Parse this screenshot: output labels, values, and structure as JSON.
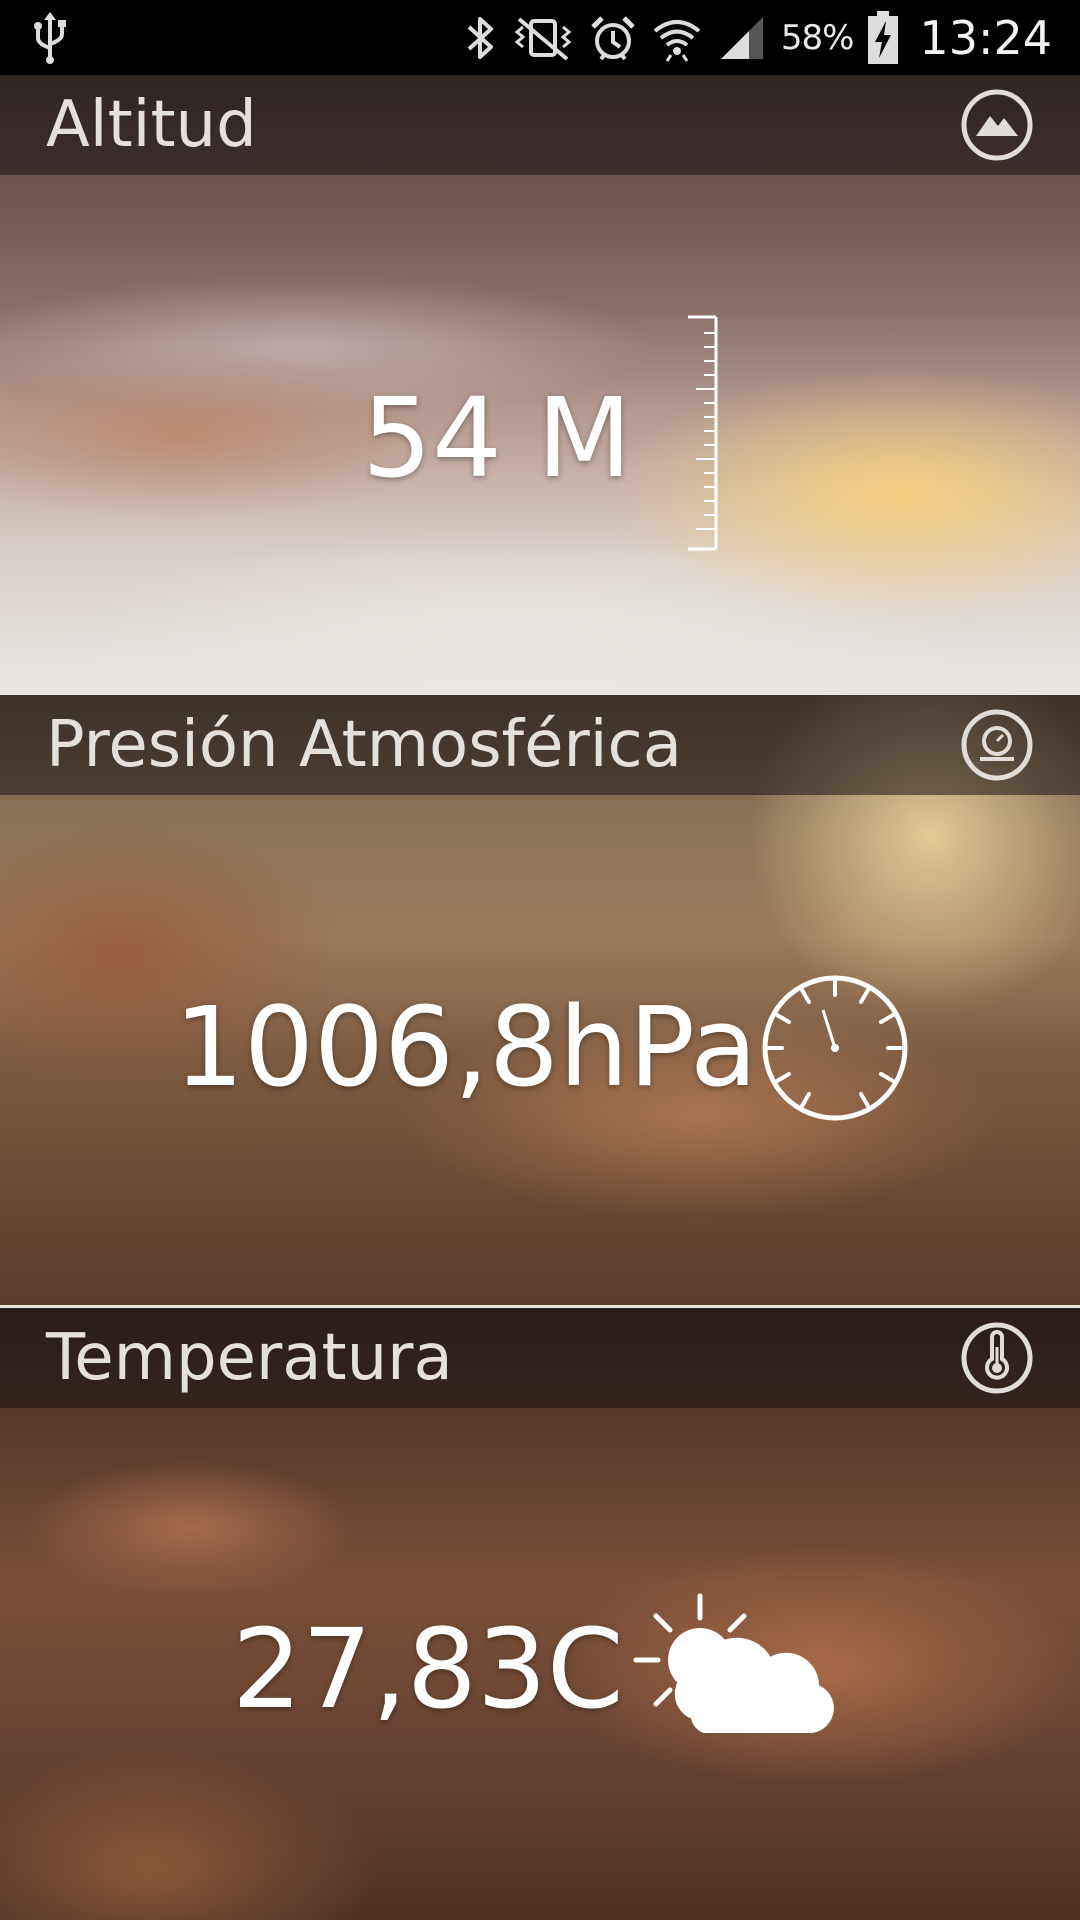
{
  "status_bar": {
    "battery_percent": "58%",
    "time": "13:24",
    "icons": [
      "usb-icon",
      "bluetooth-icon",
      "vibrate-icon",
      "alarm-icon",
      "wifi-icon",
      "signal-icon",
      "battery-charging-icon"
    ]
  },
  "panels": [
    {
      "id": "altitude",
      "title": "Altitud",
      "value": "54 M",
      "header_icon": "mountain-icon",
      "value_icon": "ruler-icon"
    },
    {
      "id": "pressure",
      "title": "Presión Atmosférica",
      "value": "1006,8hPa",
      "header_icon": "barometer-icon",
      "value_icon": "gauge-icon"
    },
    {
      "id": "temperature",
      "title": "Temperatura",
      "value": "27,83C",
      "header_icon": "thermometer-icon",
      "value_icon": "partly-cloudy-icon"
    }
  ]
}
